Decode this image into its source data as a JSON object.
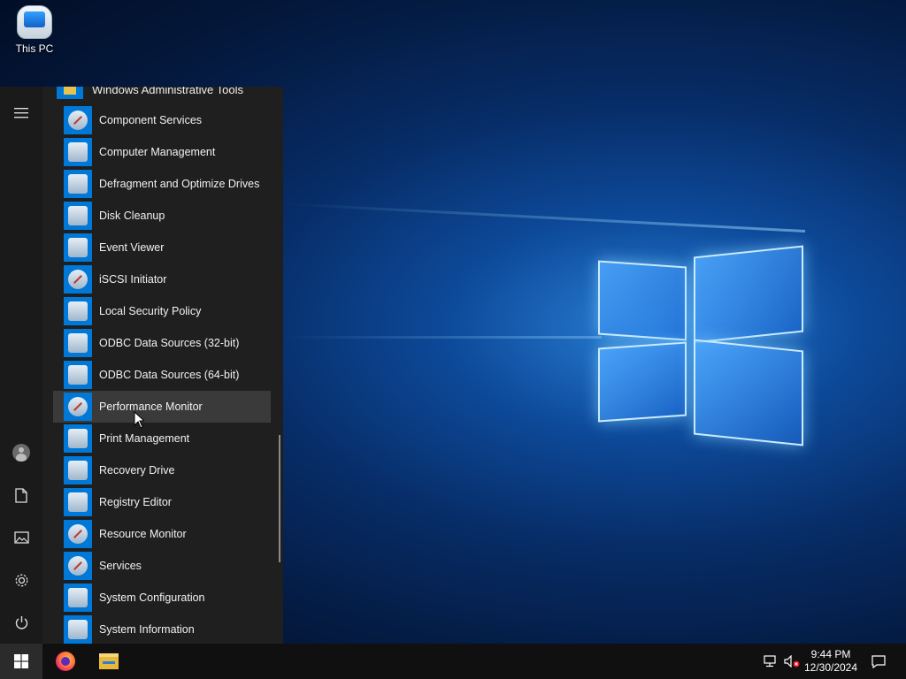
{
  "desktop": {
    "icons": [
      {
        "label": "This PC",
        "icon": "this-pc-icon"
      }
    ]
  },
  "start_menu": {
    "group": {
      "label": "Windows Administrative Tools",
      "icon": "folder-icon",
      "expanded": true
    },
    "apps": [
      {
        "label": "Component Services",
        "icon": "component-services-icon"
      },
      {
        "label": "Computer Management",
        "icon": "computer-management-icon"
      },
      {
        "label": "Defragment and Optimize Drives",
        "icon": "defragment-icon"
      },
      {
        "label": "Disk Cleanup",
        "icon": "disk-cleanup-icon"
      },
      {
        "label": "Event Viewer",
        "icon": "event-viewer-icon"
      },
      {
        "label": "iSCSI Initiator",
        "icon": "iscsi-initiator-icon"
      },
      {
        "label": "Local Security Policy",
        "icon": "local-security-policy-icon"
      },
      {
        "label": "ODBC Data Sources (32-bit)",
        "icon": "odbc-icon"
      },
      {
        "label": "ODBC Data Sources (64-bit)",
        "icon": "odbc-icon"
      },
      {
        "label": "Performance Monitor",
        "icon": "performance-monitor-icon",
        "hovered": true
      },
      {
        "label": "Print Management",
        "icon": "print-management-icon"
      },
      {
        "label": "Recovery Drive",
        "icon": "recovery-drive-icon"
      },
      {
        "label": "Registry Editor",
        "icon": "registry-editor-icon"
      },
      {
        "label": "Resource Monitor",
        "icon": "resource-monitor-icon"
      },
      {
        "label": "Services",
        "icon": "services-icon"
      },
      {
        "label": "System Configuration",
        "icon": "system-configuration-icon"
      },
      {
        "label": "System Information",
        "icon": "system-information-icon"
      }
    ],
    "rail": [
      "hamburger-icon",
      "user-icon",
      "documents-icon",
      "pictures-icon",
      "settings-icon",
      "power-icon"
    ]
  },
  "taskbar": {
    "pinned": [
      "windows-start-icon",
      "firefox-icon",
      "file-explorer-icon"
    ],
    "tray": [
      "network-icon",
      "volume-muted-icon",
      "action-center-icon"
    ],
    "clock": {
      "time": "9:44 PM",
      "date": "12/30/2024"
    }
  },
  "colors": {
    "accent": "#0078d7",
    "menu_bg": "#1f1f1f",
    "taskbar_bg": "#101010",
    "hover_bg": "#3a3a3a"
  }
}
